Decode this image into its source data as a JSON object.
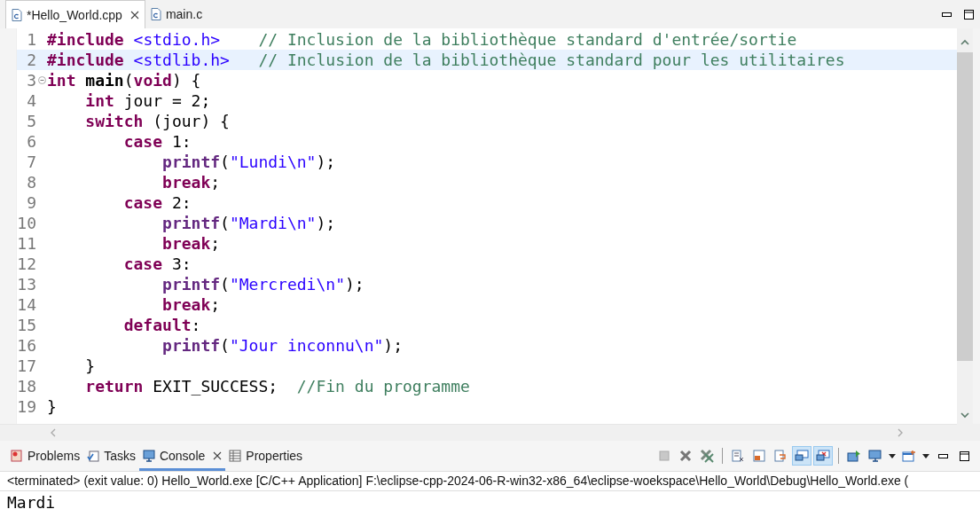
{
  "editor_tabs": [
    {
      "label": "*Hello_World.cpp",
      "selected": true,
      "closable": true
    },
    {
      "label": "main.c",
      "selected": false,
      "closable": false
    }
  ],
  "code_lines": [
    {
      "number": "1",
      "current": false,
      "fold": false,
      "tokens": [
        {
          "kind": "directive",
          "t": "#include"
        },
        {
          "kind": "header",
          "t": " <stdio.h>"
        },
        {
          "kind": "comment",
          "t": "    // Inclusion de la bibliothèque standard d'entrée/sortie"
        }
      ]
    },
    {
      "number": "2",
      "current": true,
      "fold": false,
      "tokens": [
        {
          "kind": "directive",
          "t": "#include"
        },
        {
          "kind": "header",
          "t": " <stdlib.h>"
        },
        {
          "kind": "comment",
          "t": "   // Inclusion de la bibliothèque standard pour les utilitaires"
        }
      ]
    },
    {
      "number": "3",
      "current": false,
      "fold": true,
      "tokens": [
        {
          "kind": "keyword",
          "t": "int"
        },
        {
          "kind": "bold",
          "t": " main"
        },
        {
          "kind": "plain",
          "t": "("
        },
        {
          "kind": "keyword",
          "t": "void"
        },
        {
          "kind": "plain",
          "t": ") {"
        }
      ]
    },
    {
      "number": "4",
      "current": false,
      "fold": false,
      "tokens": [
        {
          "kind": "keyword",
          "t": "    int"
        },
        {
          "kind": "plain",
          "t": " jour = 2;"
        }
      ]
    },
    {
      "number": "5",
      "current": false,
      "fold": false,
      "tokens": [
        {
          "kind": "keyword",
          "t": "    switch"
        },
        {
          "kind": "plain",
          "t": " (jour) {"
        }
      ]
    },
    {
      "number": "6",
      "current": false,
      "fold": false,
      "tokens": [
        {
          "kind": "keyword",
          "t": "        case"
        },
        {
          "kind": "plain",
          "t": " 1:"
        }
      ]
    },
    {
      "number": "7",
      "current": false,
      "fold": false,
      "tokens": [
        {
          "kind": "func",
          "t": "            printf"
        },
        {
          "kind": "plain",
          "t": "("
        },
        {
          "kind": "string",
          "t": "\"Lundi\\n\""
        },
        {
          "kind": "plain",
          "t": ");"
        }
      ]
    },
    {
      "number": "8",
      "current": false,
      "fold": false,
      "tokens": [
        {
          "kind": "keyword",
          "t": "            break"
        },
        {
          "kind": "plain",
          "t": ";"
        }
      ]
    },
    {
      "number": "9",
      "current": false,
      "fold": false,
      "tokens": [
        {
          "kind": "keyword",
          "t": "        case"
        },
        {
          "kind": "plain",
          "t": " 2:"
        }
      ]
    },
    {
      "number": "10",
      "current": false,
      "fold": false,
      "tokens": [
        {
          "kind": "func",
          "t": "            printf"
        },
        {
          "kind": "plain",
          "t": "("
        },
        {
          "kind": "string",
          "t": "\"Mardi\\n\""
        },
        {
          "kind": "plain",
          "t": ");"
        }
      ]
    },
    {
      "number": "11",
      "current": false,
      "fold": false,
      "tokens": [
        {
          "kind": "keyword",
          "t": "            break"
        },
        {
          "kind": "plain",
          "t": ";"
        }
      ]
    },
    {
      "number": "12",
      "current": false,
      "fold": false,
      "tokens": [
        {
          "kind": "keyword",
          "t": "        case"
        },
        {
          "kind": "plain",
          "t": " 3:"
        }
      ]
    },
    {
      "number": "13",
      "current": false,
      "fold": false,
      "tokens": [
        {
          "kind": "func",
          "t": "            printf"
        },
        {
          "kind": "plain",
          "t": "("
        },
        {
          "kind": "string",
          "t": "\"Mercredi\\n\""
        },
        {
          "kind": "plain",
          "t": ");"
        }
      ]
    },
    {
      "number": "14",
      "current": false,
      "fold": false,
      "tokens": [
        {
          "kind": "keyword",
          "t": "            break"
        },
        {
          "kind": "plain",
          "t": ";"
        }
      ]
    },
    {
      "number": "15",
      "current": false,
      "fold": false,
      "tokens": [
        {
          "kind": "keyword",
          "t": "        default"
        },
        {
          "kind": "plain",
          "t": ":"
        }
      ]
    },
    {
      "number": "16",
      "current": false,
      "fold": false,
      "tokens": [
        {
          "kind": "func",
          "t": "            printf"
        },
        {
          "kind": "plain",
          "t": "("
        },
        {
          "kind": "string",
          "t": "\"Jour inconnu\\n\""
        },
        {
          "kind": "plain",
          "t": ");"
        }
      ]
    },
    {
      "number": "17",
      "current": false,
      "fold": false,
      "tokens": [
        {
          "kind": "plain",
          "t": "    }"
        }
      ]
    },
    {
      "number": "18",
      "current": false,
      "fold": false,
      "tokens": [
        {
          "kind": "keyword",
          "t": "    return"
        },
        {
          "kind": "plain",
          "t": " EXIT_SUCCESS;"
        },
        {
          "kind": "comment",
          "t": "  //Fin du programme"
        }
      ]
    },
    {
      "number": "19",
      "current": false,
      "fold": false,
      "tokens": [
        {
          "kind": "plain",
          "t": "}"
        }
      ]
    }
  ],
  "view_tabs": [
    {
      "label": "Problems",
      "selected": false,
      "closable": false
    },
    {
      "label": "Tasks",
      "selected": false,
      "closable": false
    },
    {
      "label": "Console",
      "selected": true,
      "closable": true
    },
    {
      "label": "Properties",
      "selected": false,
      "closable": false
    }
  ],
  "console_toolbar": [
    {
      "kind": "stop",
      "pressed": false
    },
    {
      "kind": "remove",
      "pressed": false
    },
    {
      "kind": "remove-all",
      "pressed": false
    },
    {
      "kind": "clear",
      "pressed": false
    },
    {
      "kind": "lock",
      "pressed": false
    },
    {
      "kind": "wrap",
      "pressed": false
    },
    {
      "kind": "out",
      "pressed": true
    },
    {
      "kind": "err",
      "pressed": true
    },
    {
      "kind": "pin",
      "pressed": false
    },
    {
      "kind": "display",
      "pressed": false
    },
    {
      "kind": "caret",
      "pressed": false
    },
    {
      "kind": "open",
      "pressed": false
    },
    {
      "kind": "caret",
      "pressed": false
    },
    {
      "kind": "minimize",
      "pressed": false
    },
    {
      "kind": "maximize",
      "pressed": false
    }
  ],
  "console_header": "<terminated> (exit value: 0) Hello_World.exe [C/C++ Application] F:\\eclipse-cpp-2024-06-R-win32-x86_64\\eclipse-woekspace\\Hello_World\\Debug\\Hello_World.exe (",
  "console_output": "Mardi"
}
